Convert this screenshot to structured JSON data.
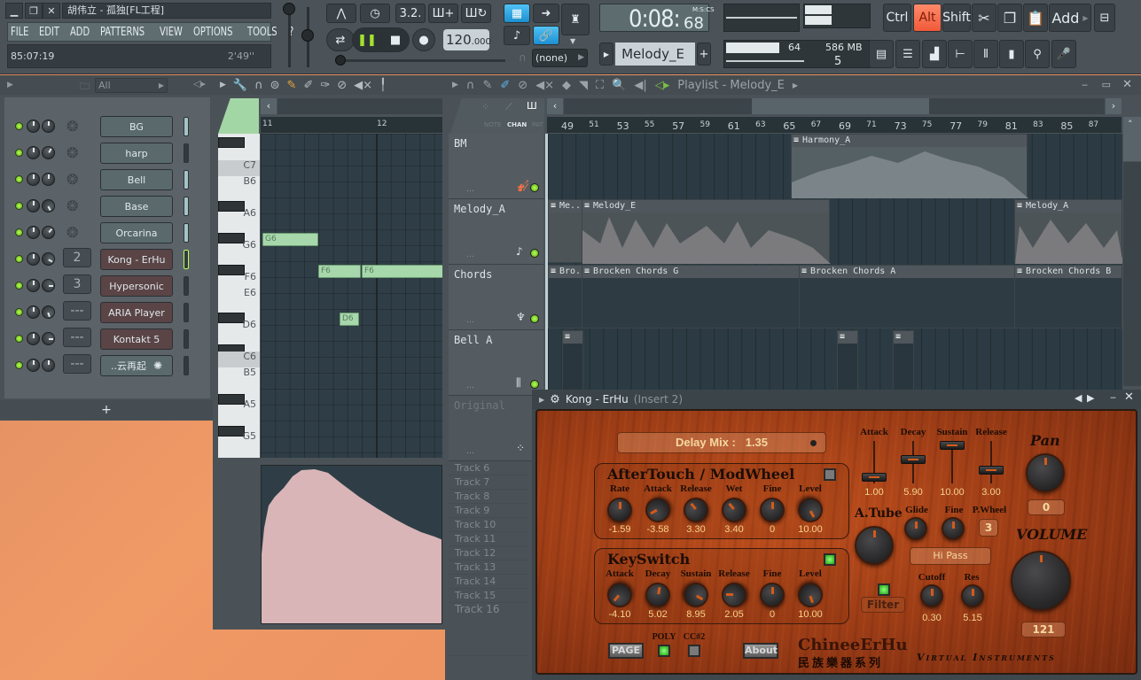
{
  "window": {
    "title": "胡伟立 - 孤独[FL工程]",
    "menu": [
      "FILE",
      "EDIT",
      "ADD",
      "PATTERNS",
      "VIEW",
      "OPTIONS",
      "TOOLS",
      "?"
    ],
    "hint_left": "85:07:19",
    "hint_right": "2'49''"
  },
  "transport": {
    "tempo": "120",
    "tempo_decimal": ".000",
    "time": "0:08:",
    "time_cs": "68",
    "time_format": "M:S:CS",
    "snap": "(none)",
    "pattern": "Melody_E",
    "polyphony": "64",
    "memory": "586 MB",
    "cpu_cores": "5",
    "song_position": 0.02
  },
  "toolbar_right": {
    "keys": [
      "Ctrl",
      "Alt",
      "Shift"
    ],
    "active_key": "Alt",
    "add_label": "Add"
  },
  "channel_rack": {
    "filter": "All",
    "channels": [
      {
        "name": "BG",
        "type": "gen",
        "number": "",
        "mini_on": true
      },
      {
        "name": "harp",
        "type": "gen",
        "number": "",
        "mini_on": false
      },
      {
        "name": "Bell",
        "type": "gen",
        "number": "",
        "mini_on": true
      },
      {
        "name": "Base",
        "type": "gen",
        "number": "",
        "mini_on": true
      },
      {
        "name": "Orcarina",
        "type": "gen",
        "number": "",
        "mini_on": true
      },
      {
        "name": "Kong - ErHu",
        "type": "plug",
        "number": "2",
        "mini_on": false,
        "selected": true
      },
      {
        "name": "Hypersonic",
        "type": "plug",
        "number": "3",
        "mini_on": false
      },
      {
        "name": "ARIA Player",
        "type": "plug",
        "number": "---",
        "mini_on": false
      },
      {
        "name": "Kontakt 5",
        "type": "plug",
        "number": "---",
        "mini_on": false
      },
      {
        "name": "..云再起",
        "type": "gen",
        "number": "---",
        "mini_on": false
      }
    ],
    "add_label": "+"
  },
  "piano_roll": {
    "bars": [
      "11",
      "12"
    ],
    "keys": [
      "C7",
      "B6",
      "A6",
      "G6",
      "F6",
      "E6",
      "D6",
      "C6",
      "B5",
      "A5",
      "G5"
    ],
    "notes": [
      {
        "label": "G6"
      },
      {
        "label": "F6"
      },
      {
        "label": "F6"
      },
      {
        "label": "D6"
      }
    ]
  },
  "playlist": {
    "title": "Playlist - Melody_E",
    "tabs": [
      "NOTE",
      "CHAN",
      "PAT"
    ],
    "active_tab": "CHAN",
    "ruler": [
      "49",
      "51",
      "53",
      "55",
      "57",
      "59",
      "61",
      "63",
      "65",
      "67",
      "69",
      "71",
      "73",
      "75",
      "77",
      "79",
      "81",
      "83",
      "85",
      "87"
    ],
    "tracks": [
      {
        "name": "BM"
      },
      {
        "name": "Melody_A"
      },
      {
        "name": "Chords"
      },
      {
        "name": "Bell A"
      },
      {
        "name": "Original"
      }
    ],
    "clips": {
      "bm": [
        "Harmony_A"
      ],
      "melody": [
        "Me..",
        "Melody_E",
        "Melody_A"
      ],
      "chords": [
        "Bro..",
        "Brocken Chords G",
        "Brocken Chords A",
        "Brocken Chords B"
      ]
    },
    "small_tracks": [
      "Track 6",
      "Track 7",
      "Track 8",
      "Track 9",
      "Track 10",
      "Track 11",
      "Track 12",
      "Track 13",
      "Track 14",
      "Track 15"
    ],
    "big_track": "Track 16"
  },
  "plugin": {
    "title": "Kong - ErHu",
    "insert": "(Insert 2)",
    "delay_mix_label": "Delay Mix :",
    "delay_mix_value": "1.35",
    "aftertouch": {
      "title": "AfterTouch / ModWheel",
      "knobs": [
        {
          "label": "Rate",
          "value": "-1.59"
        },
        {
          "label": "Attack",
          "value": "-3.58"
        },
        {
          "label": "Release",
          "value": "3.30"
        },
        {
          "label": "Wet",
          "value": "3.40"
        },
        {
          "label": "Fine",
          "value": "0"
        },
        {
          "label": "Level",
          "value": "10.00"
        }
      ]
    },
    "keyswitch": {
      "title": "KeySwitch",
      "knobs": [
        {
          "label": "Attack",
          "value": "-4.10"
        },
        {
          "label": "Decay",
          "value": "5.02"
        },
        {
          "label": "Sustain",
          "value": "8.95"
        },
        {
          "label": "Release",
          "value": "2.05"
        },
        {
          "label": "Fine",
          "value": "0"
        },
        {
          "label": "Level",
          "value": "10.00"
        }
      ]
    },
    "envelope": [
      {
        "label": "Attack",
        "value": "1.00",
        "level": 0.1
      },
      {
        "label": "Decay",
        "value": "5.90",
        "level": 0.59
      },
      {
        "label": "Sustain",
        "value": "10.00",
        "level": 1.0
      },
      {
        "label": "Release",
        "value": "3.00",
        "level": 0.3
      }
    ],
    "pan_label": "Pan",
    "pan_value": "0",
    "volume_label": "VOLUME",
    "volume_value": "121",
    "atube_label": "A.Tube",
    "glide_label": "Glide",
    "fine_label": "Fine",
    "pwheel_label": "P.Wheel",
    "pwheel_value": "3",
    "filter_type": "Hi Pass",
    "filter_label": "Filter",
    "cutoff_label": "Cutoff",
    "cutoff_value": "0.30",
    "res_label": "Res",
    "res_value": "5.15",
    "page_label": "PAGE",
    "about_label": "About",
    "poly_label": "POLY",
    "cc_label": "CC#2",
    "brand": "ChineeErHu",
    "brand_cn": "民族樂器系列",
    "brand_sub": "Virtual Instruments"
  }
}
